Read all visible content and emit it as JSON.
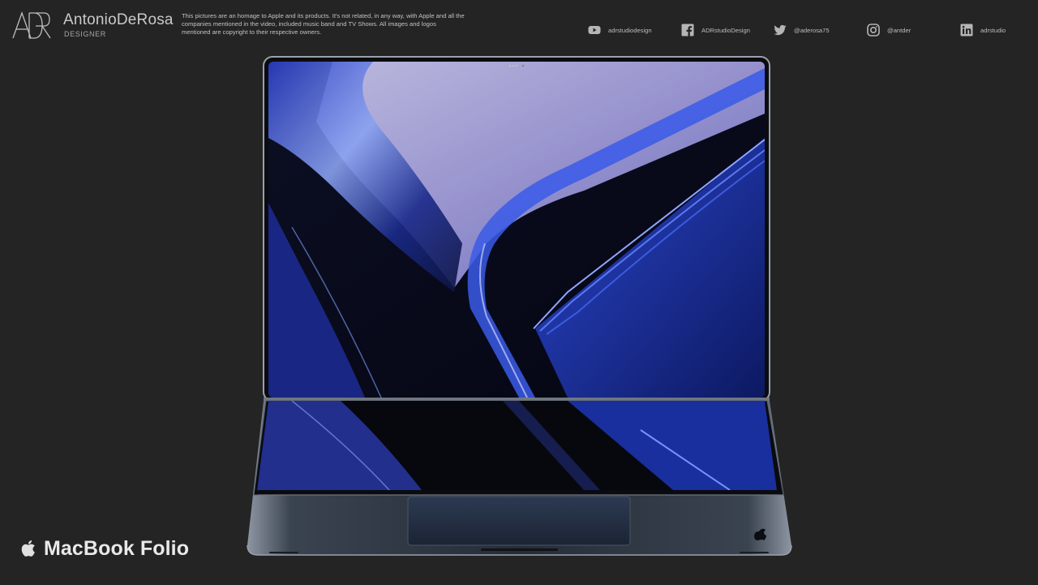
{
  "header": {
    "brand_name": "AntonioDeRosa",
    "brand_role": "DESIGNER",
    "disclaimer": "This pictures are an homage to Apple and its products.  It's not related, in any way, with Apple and all the companies mentioned in the video, included music band and TV Shows. All images and logos mentioned are copyright to their respective owners."
  },
  "social": [
    {
      "icon": "youtube-icon",
      "handle": "adrstudiodesign"
    },
    {
      "icon": "facebook-icon",
      "handle": "ADRstudioDesign"
    },
    {
      "icon": "twitter-icon",
      "handle": "@aderosa75"
    },
    {
      "icon": "instagram-icon",
      "handle": "@antder"
    },
    {
      "icon": "linkedin-icon",
      "handle": "adrstudio"
    }
  ],
  "product": {
    "icon": "apple-logo-icon",
    "name": "MacBook Folio"
  },
  "colors": {
    "background": "#242424",
    "screen_blue": "#1f3fb8",
    "screen_lilac": "#a89fd6"
  }
}
